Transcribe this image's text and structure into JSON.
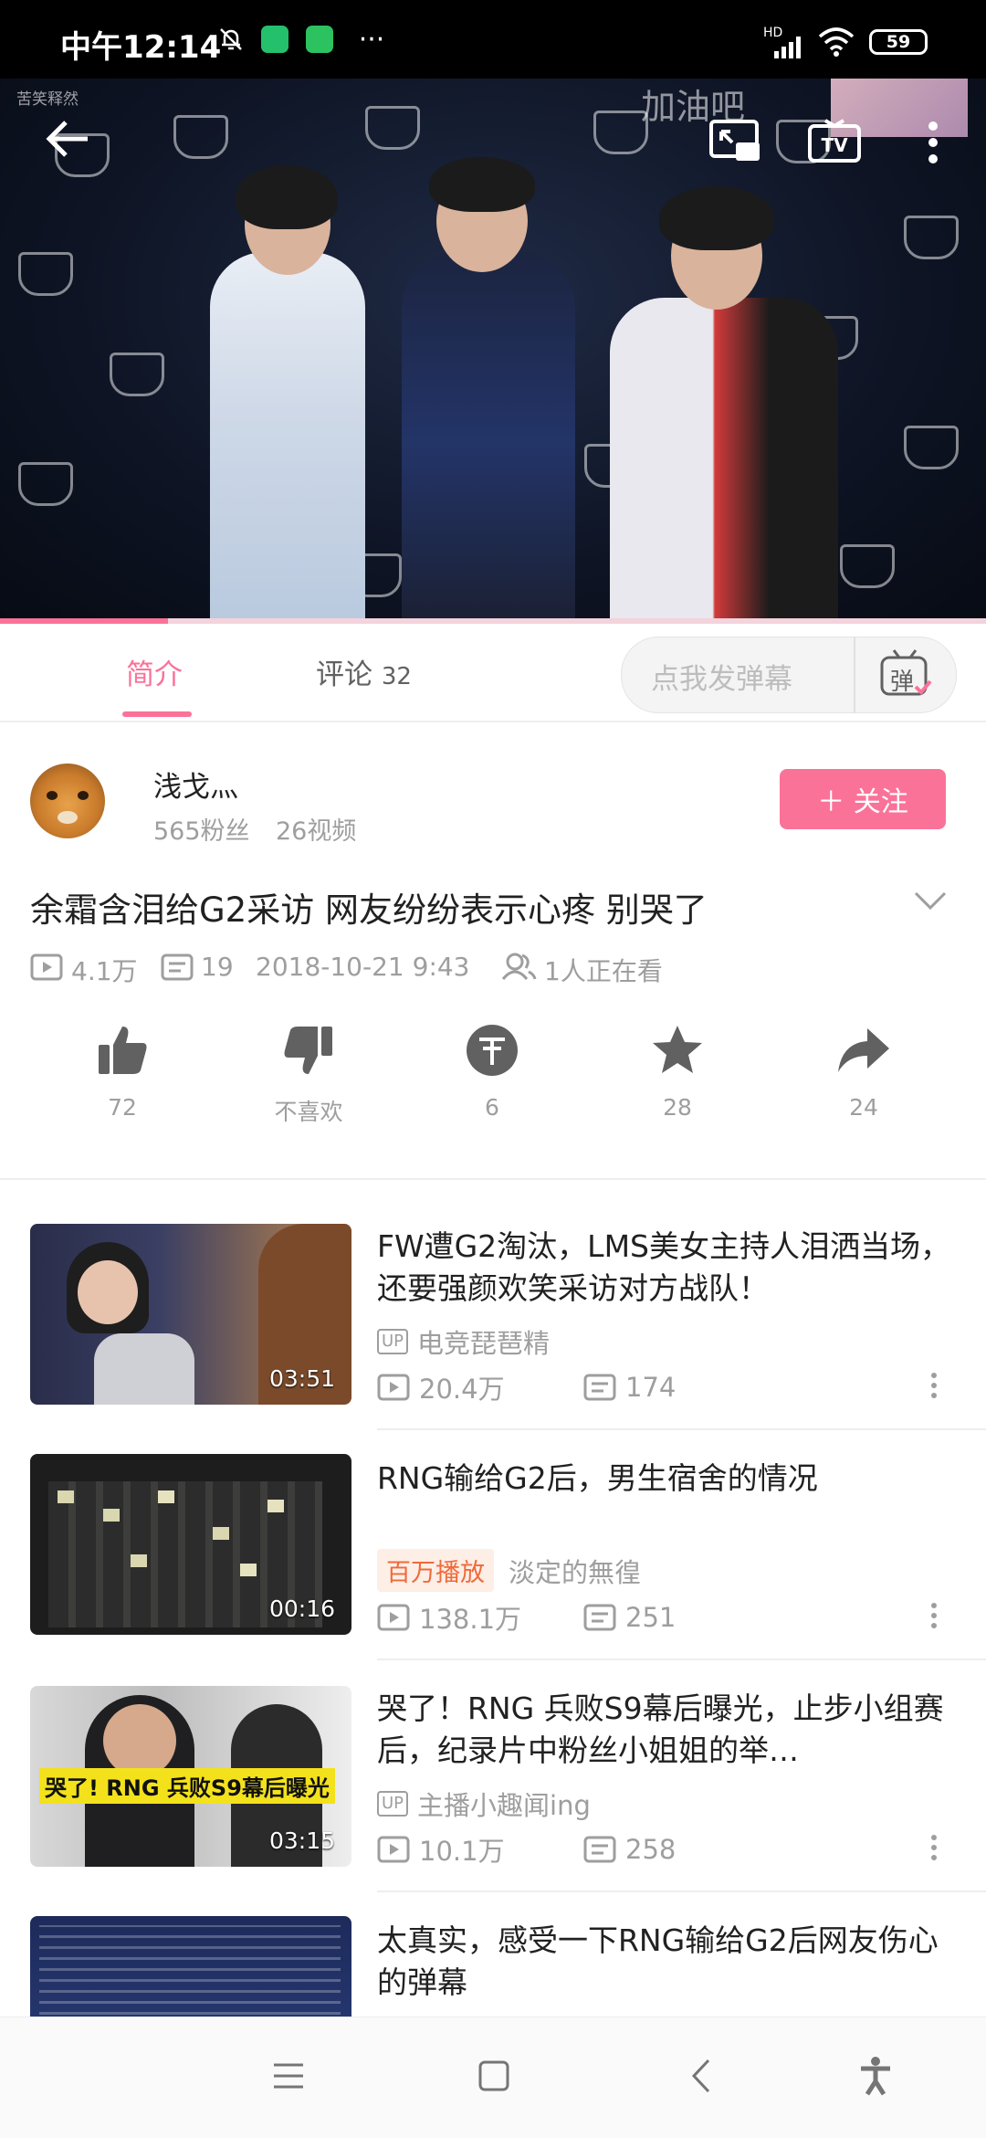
{
  "status_bar": {
    "time": "中午12:14",
    "battery": "59",
    "network": "HD"
  },
  "video": {
    "watermark": "加油吧",
    "uploader_watermark": "苦笑释然",
    "progress": 0.17
  },
  "tabs": {
    "intro": "简介",
    "comments": "评论",
    "comment_count": "32",
    "danmu_placeholder": "点我发弹幕",
    "danmu_button": "弹"
  },
  "uploader": {
    "name": "浅戈灬",
    "fans": "565粉丝",
    "videos": "26视频",
    "follow_label": "＋ 关注"
  },
  "info": {
    "title": "余霜含泪给G2采访 网友纷纷表示心疼 别哭了",
    "views": "4.1万",
    "danmaku": "19",
    "date": "2018-10-21 9:43",
    "watching": "1人正在看"
  },
  "actions": [
    {
      "icon": "thumb-up-icon",
      "label": "72"
    },
    {
      "icon": "thumb-down-icon",
      "label": "不喜欢"
    },
    {
      "icon": "coin-icon",
      "label": "6"
    },
    {
      "icon": "star-icon",
      "label": "28"
    },
    {
      "icon": "share-icon",
      "label": "24"
    }
  ],
  "related": [
    {
      "title": "FW遭G2淘汰，LMS美女主持人泪洒当场，还要强颜欢笑采访对方战队！",
      "duration": "03:51",
      "up_badge": "UP",
      "author": "电竞琵琶精",
      "views": "20.4万",
      "danmaku": "174"
    },
    {
      "title": "RNG输给G2后，男生宿舍的情况",
      "duration": "00:16",
      "hot_badge": "百万播放",
      "author": "淡定的無徨",
      "views": "138.1万",
      "danmaku": "251"
    },
    {
      "title": "哭了！RNG 兵败S9幕后曝光，止步小组赛后，纪录片中粉丝小姐姐的举…",
      "duration": "03:15",
      "thumb_text": "哭了! RNG 兵败S9幕后曝光",
      "up_badge": "UP",
      "author": "主播小趣闻ing",
      "views": "10.1万",
      "danmaku": "258"
    },
    {
      "title": "太真实，感受一下RNG输给G2后网友伤心的弹幕"
    }
  ],
  "colors": {
    "accent": "#fb7299",
    "text": "#212121",
    "muted": "#9e9e9e"
  }
}
